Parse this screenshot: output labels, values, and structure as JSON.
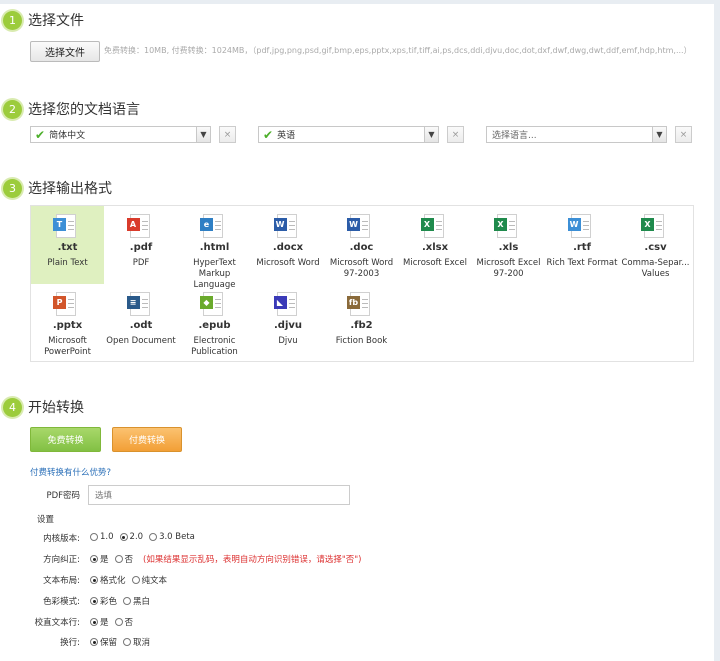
{
  "steps": {
    "s1": {
      "num": "1",
      "title": "选择文件"
    },
    "s2": {
      "num": "2",
      "title": "选择您的文档语言"
    },
    "s3": {
      "num": "3",
      "title": "选择输出格式"
    },
    "s4": {
      "num": "4",
      "title": "开始转换"
    }
  },
  "upload": {
    "button_label": "选择文件",
    "hint": "免费转换：10MB, 付费转换：1024MB，（pdf,jpg,png,psd,gif,bmp,eps,pptx,xps,tif,tiff,ai,ps,dcs,ddi,djvu,doc,dot,dxf,dwf,dwg,dwt,ddf,emf,hdp,htm,...）"
  },
  "languages": [
    {
      "value": "简体中文",
      "checked": true
    },
    {
      "value": "英语",
      "checked": true
    },
    {
      "value": "选择语言...",
      "checked": false
    }
  ],
  "remove_label": "×",
  "dropdown_arrow": "▼",
  "check_mark": "✔",
  "formats": [
    {
      "ext": ".txt",
      "name": "Plain Text",
      "icon": "txt-file-icon",
      "badge": "T",
      "color": "#3c8fd6",
      "selected": true
    },
    {
      "ext": ".pdf",
      "name": "PDF",
      "icon": "pdf-file-icon",
      "badge": "A",
      "color": "#d93b2b",
      "selected": false
    },
    {
      "ext": ".html",
      "name": "HyperText Markup Language",
      "icon": "html-file-icon",
      "badge": "e",
      "color": "#2f7fc4",
      "selected": false
    },
    {
      "ext": ".docx",
      "name": "Microsoft Word",
      "icon": "word-file-icon",
      "badge": "W",
      "color": "#2b5ca8",
      "selected": false
    },
    {
      "ext": ".doc",
      "name": "Microsoft Word 97-2003",
      "icon": "word-file-icon",
      "badge": "W",
      "color": "#2b5ca8",
      "selected": false
    },
    {
      "ext": ".xlsx",
      "name": "Microsoft Excel",
      "icon": "excel-file-icon",
      "badge": "X",
      "color": "#1f8a4c",
      "selected": false
    },
    {
      "ext": ".xls",
      "name": "Microsoft Excel 97-200",
      "icon": "excel-file-icon",
      "badge": "X",
      "color": "#1f8a4c",
      "selected": false
    },
    {
      "ext": ".rtf",
      "name": "Rich Text Format",
      "icon": "rtf-file-icon",
      "badge": "W",
      "color": "#3c8fd6",
      "selected": false
    },
    {
      "ext": ".csv",
      "name": "Comma-Separ... Values",
      "icon": "csv-file-icon",
      "badge": "X",
      "color": "#1f8a4c",
      "selected": false
    },
    {
      "ext": ".pptx",
      "name": "Microsoft PowerPoint",
      "icon": "powerpoint-file-icon",
      "badge": "P",
      "color": "#d2552a",
      "selected": false
    },
    {
      "ext": ".odt",
      "name": "Open Document",
      "icon": "odt-file-icon",
      "badge": "≡",
      "color": "#2a5a8a",
      "selected": false
    },
    {
      "ext": ".epub",
      "name": "Electronic Publication",
      "icon": "epub-file-icon",
      "badge": "◆",
      "color": "#6aaa2c",
      "selected": false
    },
    {
      "ext": ".djvu",
      "name": "Djvu",
      "icon": "djvu-file-icon",
      "badge": "◣",
      "color": "#3a3ab8",
      "selected": false
    },
    {
      "ext": ".fb2",
      "name": "Fiction Book",
      "icon": "fb2-file-icon",
      "badge": "fb",
      "color": "#8a6a3a",
      "selected": false
    }
  ],
  "convert": {
    "free_label": "免费转换",
    "paid_label": "付费转换",
    "advantage_link": "付费转换有什么优势?"
  },
  "settings": {
    "pdf_password_label": "PDF密码",
    "pdf_password_placeholder": "选填",
    "section_title": "设置",
    "rows": [
      {
        "label": "内核版本:",
        "options": [
          {
            "text": "1.0",
            "on": false
          },
          {
            "text": "2.0",
            "on": true
          },
          {
            "text": "3.0 Beta",
            "on": false
          }
        ],
        "note": ""
      },
      {
        "label": "方向纠正:",
        "options": [
          {
            "text": "是",
            "on": true
          },
          {
            "text": "否",
            "on": false
          }
        ],
        "note": "(如果结果显示乱码，表明自动方向识别错误，请选择\"否\")"
      },
      {
        "label": "文本布局:",
        "options": [
          {
            "text": "格式化",
            "on": true
          },
          {
            "text": "纯文本",
            "on": false
          }
        ],
        "note": ""
      },
      {
        "label": "色彩模式:",
        "options": [
          {
            "text": "彩色",
            "on": true
          },
          {
            "text": "黑白",
            "on": false
          }
        ],
        "note": ""
      },
      {
        "label": "校直文本行:",
        "options": [
          {
            "text": "是",
            "on": true
          },
          {
            "text": "否",
            "on": false
          }
        ],
        "note": ""
      },
      {
        "label": "换行:",
        "options": [
          {
            "text": "保留",
            "on": true
          },
          {
            "text": "取消",
            "on": false
          }
        ],
        "note": ""
      }
    ]
  }
}
